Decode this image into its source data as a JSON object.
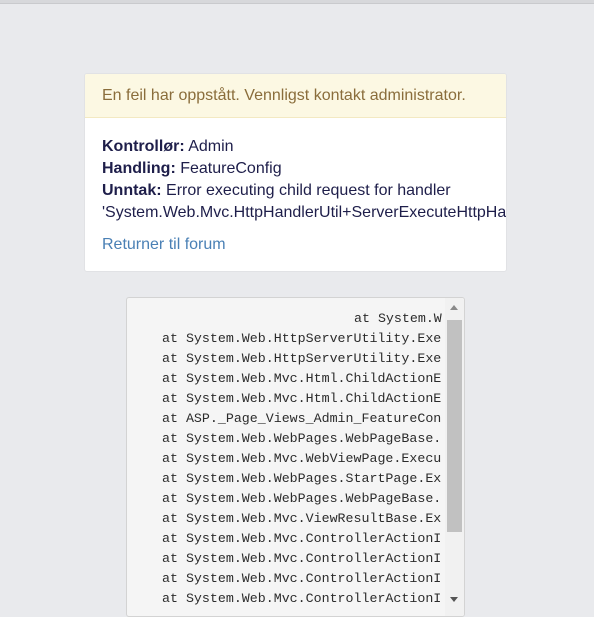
{
  "alert": {
    "message": "En feil har oppstått. Vennligst kontakt administrator."
  },
  "details": {
    "controller_label": "Kontrollør:",
    "controller_value": "Admin",
    "action_label": "Handling:",
    "action_value": "FeatureConfig",
    "exception_label": "Unntak:",
    "exception_value": "Error executing child request for handler",
    "exception_continuation": "'System.Web.Mvc.HttpHandlerUtil+ServerExecuteHttpHandlerAsyncWr"
  },
  "return_link": "Returner til forum",
  "stack_trace": [
    "at System.W",
    "at System.Web.HttpServerUtility.Exe",
    "at System.Web.HttpServerUtility.Exe",
    "at System.Web.Mvc.Html.ChildActionE",
    "at System.Web.Mvc.Html.ChildActionE",
    "at ASP._Page_Views_Admin_FeatureCon",
    "at System.Web.WebPages.WebPageBase.",
    "at System.Web.Mvc.WebViewPage.Execu",
    "at System.Web.WebPages.StartPage.Ex",
    "at System.Web.WebPages.WebPageBase.",
    "at System.Web.Mvc.ViewResultBase.Ex",
    "at System.Web.Mvc.ControllerActionI",
    "at System.Web.Mvc.ControllerActionI",
    "at System.Web.Mvc.ControllerActionI",
    "at System.Web.Mvc.ControllerActionI"
  ],
  "colors": {
    "page_background": "#e9eaed",
    "alert_background": "#fcf8e3",
    "alert_text": "#8a6d3b",
    "link": "#4a80b5",
    "body_text": "#1e1e4a"
  }
}
